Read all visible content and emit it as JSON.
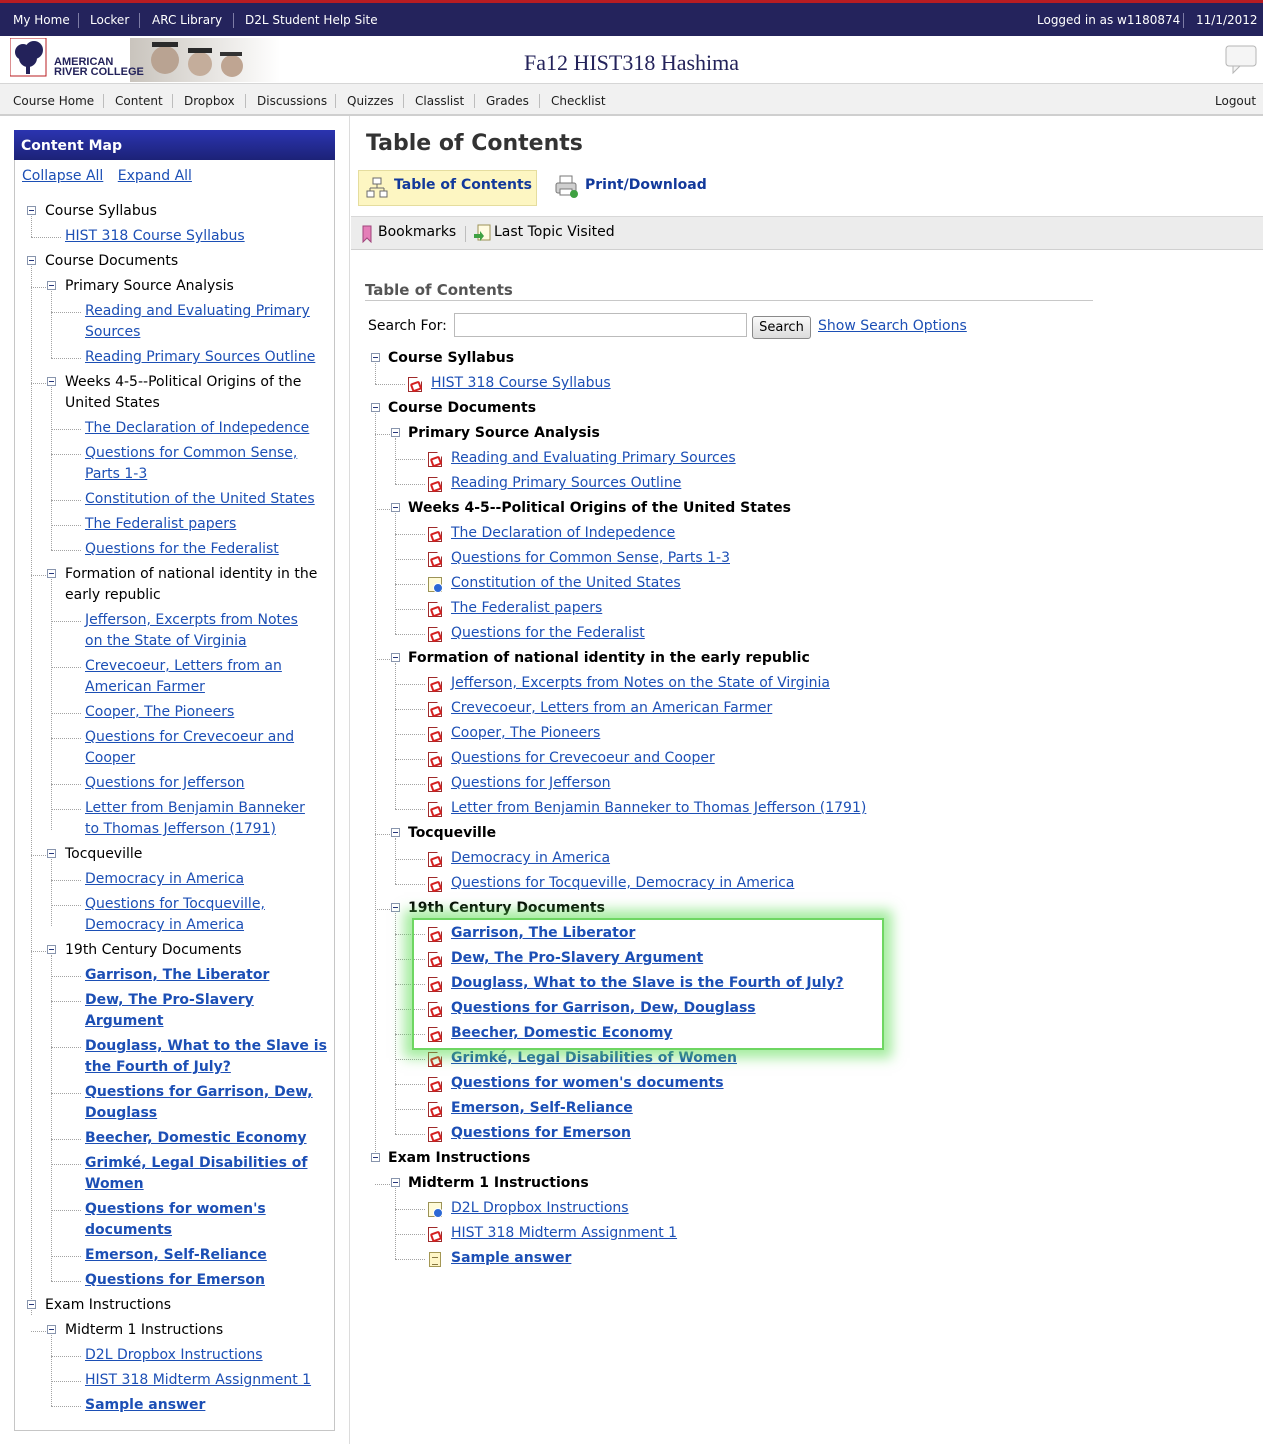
{
  "topbar": {
    "links": [
      "My Home",
      "Locker",
      "ARC Library",
      "D2L Student Help Site"
    ],
    "logged_in": "Logged in as w1180874",
    "date": "11/1/2012"
  },
  "header": {
    "logo_line1": "AMERICAN",
    "logo_line2": "RIVER COLLEGE",
    "course_title": "Fa12 HIST318 Hashima"
  },
  "nav": {
    "items": [
      "Course Home",
      "Content",
      "Dropbox",
      "Discussions",
      "Quizzes",
      "Classlist",
      "Grades",
      "Checklist"
    ],
    "logout": "Logout"
  },
  "content_map": {
    "title": "Content Map",
    "collapse": "Collapse All",
    "expand": "Expand All",
    "lines": [
      "Course Syllabus",
      "HIST 318 Course Syllabus",
      "Course Documents",
      "Primary Source Analysis",
      "Reading and Evaluating Primary",
      "Sources",
      "Reading Primary Sources Outline",
      "Weeks 4-5--Political Origins of the",
      "United States",
      "The Declaration of Indepedence",
      "Questions for Common Sense,",
      "Parts 1-3",
      "Constitution of the United States",
      "The Federalist papers",
      "Questions for the Federalist",
      "Formation of national identity in the",
      "early republic",
      "Jefferson, Excerpts from Notes",
      "on the State of Virginia",
      "Crevecoeur, Letters from an",
      "American Farmer",
      "Cooper, The Pioneers",
      "Questions for Crevecoeur and",
      "Cooper",
      "Questions for Jefferson",
      "Letter from Benjamin Banneker",
      "to Thomas Jefferson (1791)",
      "Tocqueville",
      "Democracy in America",
      "Questions for Tocqueville,",
      "Democracy in America",
      "19th Century Documents",
      "Garrison, The Liberator",
      "Dew, The Pro-Slavery",
      "Argument",
      "Douglass, What to the Slave is",
      "the Fourth of July?",
      "Questions for Garrison, Dew,",
      "Douglass",
      "Beecher, Domestic Economy",
      "Grimké, Legal Disabilities of",
      "Women",
      "Questions for women's",
      "documents",
      "Emerson, Self-Reliance",
      "Questions for Emerson",
      "Exam Instructions",
      "Midterm 1 Instructions",
      "D2L Dropbox Instructions",
      "HIST 318 Midterm Assignment 1",
      "Sample answer"
    ]
  },
  "main": {
    "heading": "Table of Contents",
    "tab_toc": "Table of Contents",
    "tab_print": "Print/Download",
    "bookmarks": "Bookmarks",
    "last_topic": "Last Topic Visited",
    "subheading": "Table of Contents",
    "search_label": "Search For:",
    "search_value": "",
    "search_button": "Search",
    "search_options": "Show Search Options",
    "toc": [
      "Course Syllabus",
      "HIST 318 Course Syllabus",
      "Course Documents",
      "Primary Source Analysis",
      "Reading and Evaluating Primary Sources",
      "Reading Primary Sources Outline",
      "Weeks 4-5--Political Origins of the United States",
      "The Declaration of Indepedence",
      "Questions for Common Sense, Parts 1-3",
      "Constitution of the United States",
      "The Federalist papers",
      "Questions for the Federalist",
      "Formation of national identity in the early republic",
      "Jefferson, Excerpts from Notes on the State of Virginia",
      "Crevecoeur, Letters from an American Farmer",
      "Cooper, The Pioneers",
      "Questions for Crevecoeur and Cooper",
      "Questions for Jefferson",
      "Letter from Benjamin Banneker to Thomas Jefferson (1791)",
      "Tocqueville",
      "Democracy in America",
      "Questions for Tocqueville, Democracy in America",
      "19th Century Documents",
      "Garrison, The Liberator",
      "Dew, The Pro-Slavery Argument",
      "Douglass, What to the Slave is the Fourth of July?",
      "Questions for Garrison, Dew, Douglass",
      "Beecher, Domestic Economy",
      "Grimké, Legal Disabilities of Women",
      "Questions for women's documents",
      "Emerson, Self-Reliance",
      "Questions for Emerson",
      "Exam Instructions",
      "Midterm 1 Instructions",
      "D2L Dropbox Instructions",
      "HIST 318 Midterm Assignment 1",
      "Sample answer"
    ]
  },
  "colors": {
    "topbar": "#24235c",
    "topbar_border": "#b81c22",
    "link": "#1c4fb5",
    "content_map_header": "#232a8c",
    "highlight": "#6ed662"
  }
}
